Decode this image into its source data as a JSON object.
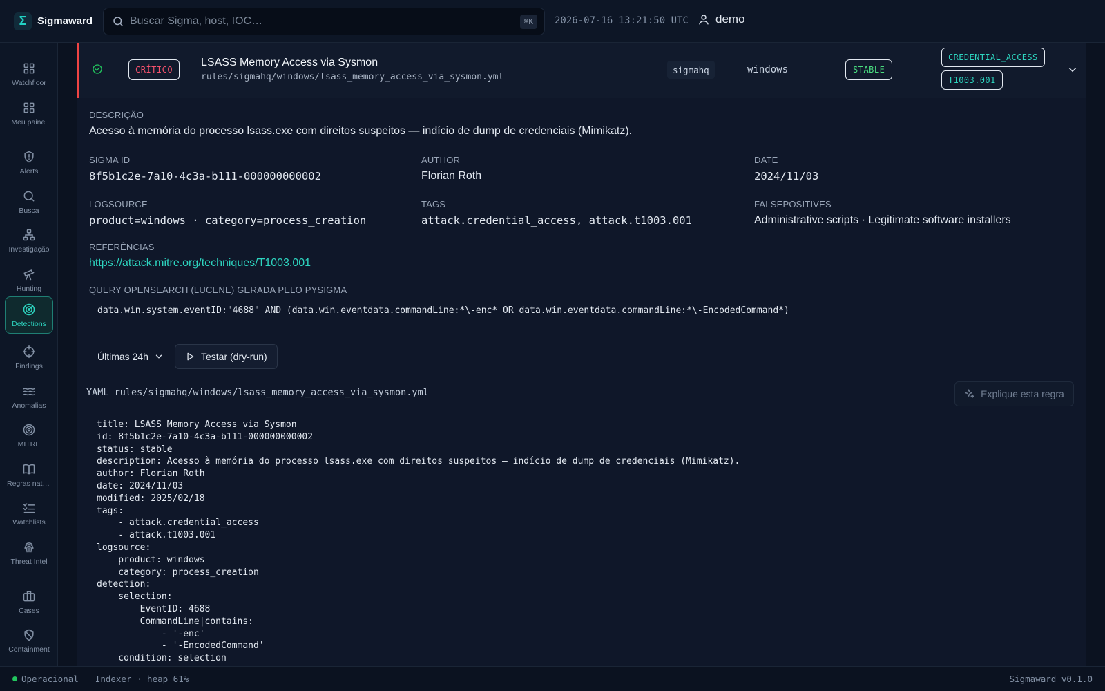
{
  "app": {
    "name": "Sigmaward",
    "logo_glyph": "Σ",
    "accent": "#2dd4bf"
  },
  "header": {
    "search_placeholder": "Buscar Sigma, host, IOC…",
    "shortcut": "⌘K",
    "clock": "2026-07-16 13:21:50 UTC",
    "user": "demo"
  },
  "sidebar": {
    "items": [
      {
        "label": "Watchfloor",
        "icon": "grid-icon"
      },
      {
        "label": "Meu painel",
        "icon": "grid-icon"
      },
      {
        "label": "Alerts",
        "icon": "shield-alert-icon"
      },
      {
        "label": "Busca",
        "icon": "search-icon"
      },
      {
        "label": "Investigação",
        "icon": "network-icon"
      },
      {
        "label": "Hunting",
        "icon": "telescope-icon"
      },
      {
        "label": "Detections",
        "icon": "radar-icon",
        "active": true
      },
      {
        "label": "Findings",
        "icon": "crosshair-icon"
      },
      {
        "label": "Anomalias",
        "icon": "waves-icon"
      },
      {
        "label": "MITRE",
        "icon": "target-icon"
      },
      {
        "label": "Regras nati…",
        "icon": "book-icon"
      },
      {
        "label": "Watchlists",
        "icon": "list-checks-icon"
      },
      {
        "label": "Threat Intel",
        "icon": "fingerprint-icon"
      },
      {
        "label": "Cases",
        "icon": "briefcase-icon"
      },
      {
        "label": "Containment",
        "icon": "shield-off-icon"
      }
    ]
  },
  "rule": {
    "severity": "CRÍTICO",
    "severity_color": "#f4516c",
    "title": "LSASS Memory Access via Sysmon",
    "path": "rules/sigmahq/windows/lsass_memory_access_via_sysmon.yml",
    "source": "sigmahq",
    "product": "windows",
    "status": "STABLE",
    "status_color": "#4ade80",
    "tags": [
      "CREDENTIAL_ACCESS",
      "T1003.001"
    ]
  },
  "details": {
    "description_label": "DESCRIÇÃO",
    "description": "Acesso à memória do processo lsass.exe com direitos suspeitos — indício de dump de credenciais (Mimikatz).",
    "sigma_id_label": "SIGMA ID",
    "sigma_id": "8f5b1c2e-7a10-4c3a-b111-000000000002",
    "author_label": "AUTHOR",
    "author": "Florian Roth",
    "date_label": "DATE",
    "date": "2024/11/03",
    "logsource_label": "LOGSOURCE",
    "logsource": "product=windows · category=process_creation",
    "tags_label": "TAGS",
    "tags": "attack.credential_access, attack.t1003.001",
    "falsepositives_label": "FALSEPOSITIVES",
    "falsepositives": "Administrative scripts · Legitimate software installers",
    "references_label": "REFERÊNCIAS",
    "reference_url": "https://attack.mitre.org/techniques/T1003.001",
    "query_label": "QUERY OPENSEARCH (LUCENE) GERADA PELO PYSIGMA",
    "query": "data.win.system.eventID:\"4688\" AND (data.win.eventdata.commandLine:*\\-enc* OR data.win.eventdata.commandLine:*\\-EncodedCommand*)"
  },
  "actions": {
    "time_range": "Últimas 24h",
    "test_button": "Testar (dry-run)",
    "explain_button": "Explique esta regra"
  },
  "yaml": {
    "label": "YAML rules/sigmahq/windows/lsass_memory_access_via_sysmon.yml",
    "content": "title: LSASS Memory Access via Sysmon\nid: 8f5b1c2e-7a10-4c3a-b111-000000000002\nstatus: stable\ndescription: Acesso à memória do processo lsass.exe com direitos suspeitos — indício de dump de credenciais (Mimikatz).\nauthor: Florian Roth\ndate: 2024/11/03\nmodified: 2025/02/18\ntags:\n    - attack.credential_access\n    - attack.t1003.001\nlogsource:\n    product: windows\n    category: process_creation\ndetection:\n    selection:\n        EventID: 4688\n        CommandLine|contains:\n            - '-enc'\n            - '-EncodedCommand'\n    condition: selection"
  },
  "footer": {
    "status": "Operacional",
    "indexer": "Indexer · heap 61%",
    "version": "Sigmaward v0.1.0"
  }
}
